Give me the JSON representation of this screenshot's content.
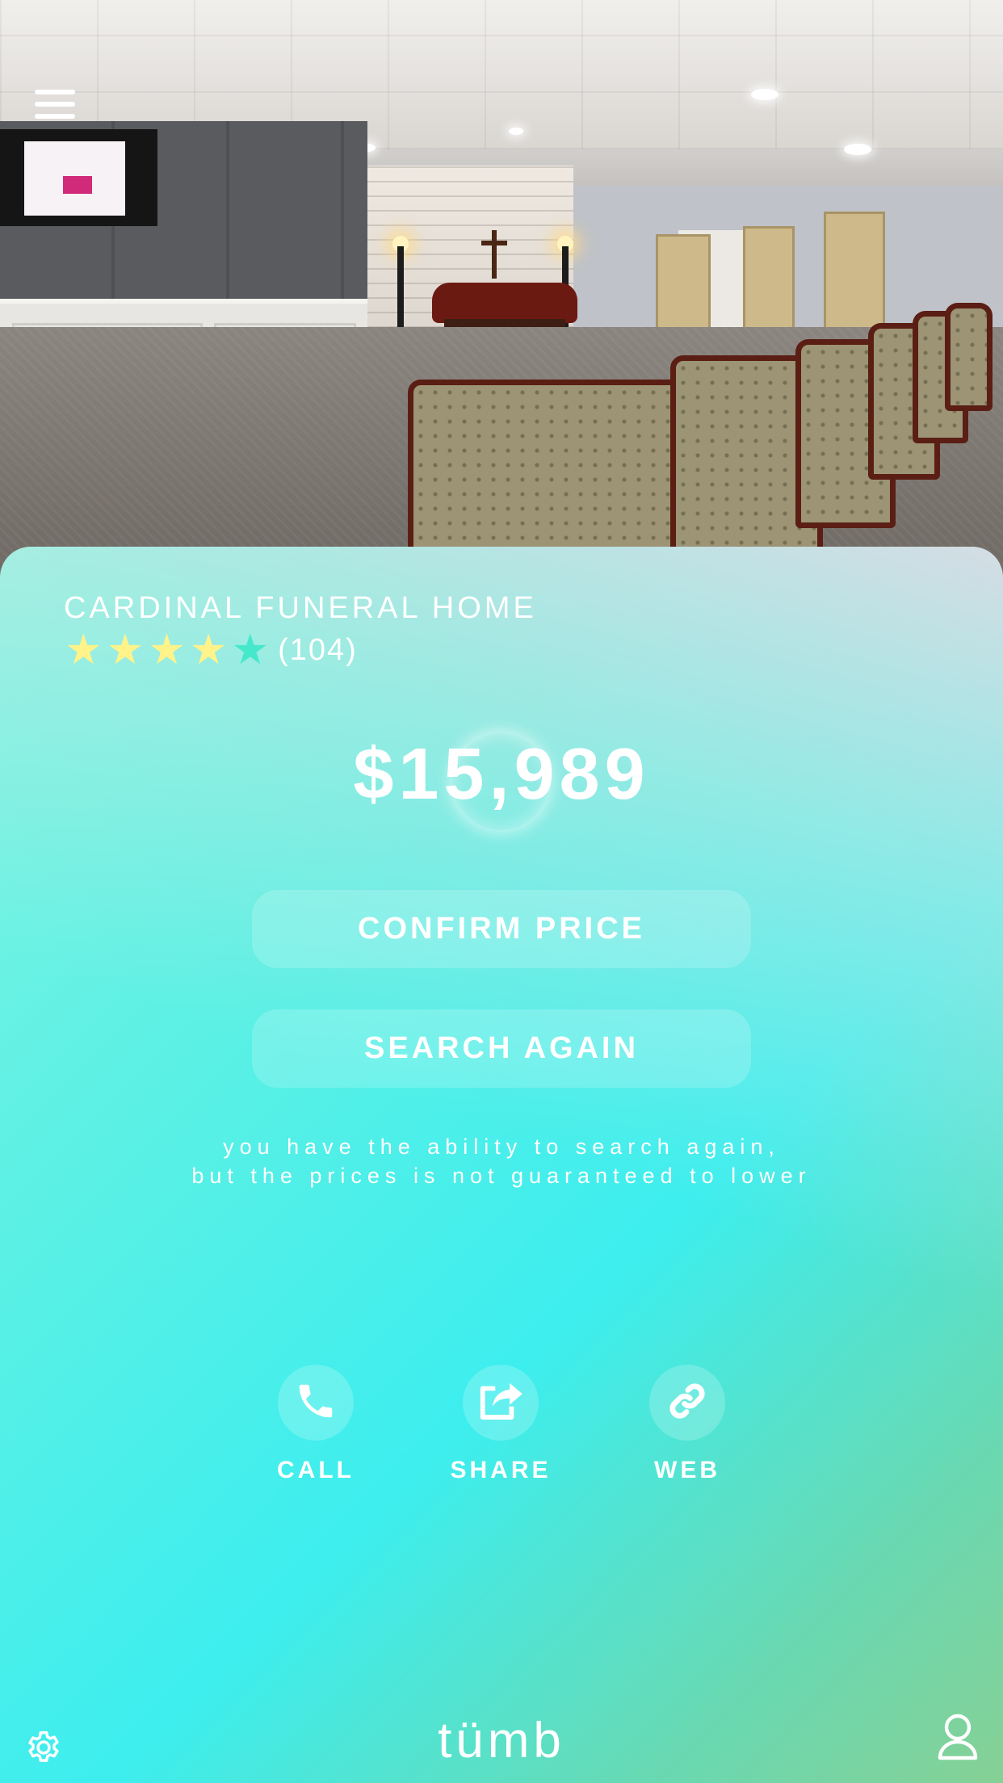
{
  "header": {
    "menu_icon": "hamburger-menu-icon"
  },
  "listing": {
    "name": "CARDINAL FUNERAL HOME",
    "rating": 4.5,
    "rating_max": 5,
    "reviews": "(104)",
    "price": "$15,989"
  },
  "buttons": {
    "confirm_label": "CONFIRM PRICE",
    "search_label": "SEARCH AGAIN"
  },
  "note": {
    "line1": "you have the ability to search again,",
    "line2": "but the prices is not guaranteed to lower"
  },
  "actions": [
    {
      "label": "CALL",
      "icon": "phone-icon"
    },
    {
      "label": "SHARE",
      "icon": "share-icon"
    },
    {
      "label": "WEB",
      "icon": "link-icon"
    }
  ],
  "footer": {
    "brand": "tümb",
    "settings_icon": "gear-icon",
    "profile_icon": "user-icon"
  },
  "colors": {
    "gradient_top": "#7ff5e2",
    "gradient_mid": "#3deeee",
    "gradient_bottom": "#86d095",
    "star_full": "#fff38a",
    "star_partial": "#46e8cc"
  }
}
